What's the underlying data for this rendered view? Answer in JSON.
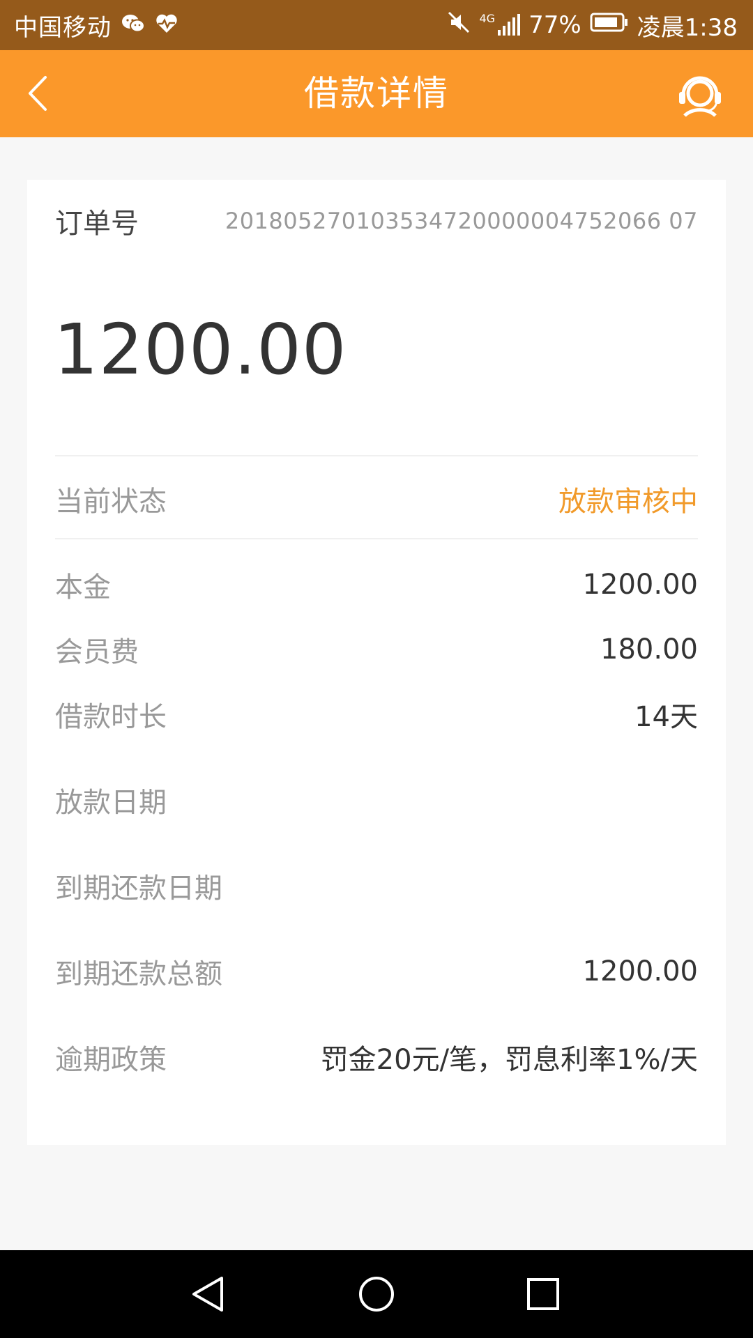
{
  "status_bar": {
    "carrier": "中国移动",
    "network": "4G",
    "battery": "77%",
    "time": "凌晨1:38",
    "icons": [
      "wechat-icon",
      "health-icon",
      "mute-icon",
      "signal-icon",
      "battery-icon"
    ]
  },
  "header": {
    "title": "借款详情",
    "back_icon": "chevron-left-icon",
    "service_icon": "customer-service-icon"
  },
  "order": {
    "label": "订单号",
    "value": "201805270103534720000004752066 07"
  },
  "amount": "1200.00",
  "details": {
    "status": {
      "label": "当前状态",
      "value": "放款审核中"
    },
    "principal": {
      "label": "本金",
      "value": "1200.00"
    },
    "membership_fee": {
      "label": "会员费",
      "value": "180.00"
    },
    "duration": {
      "label": "借款时长",
      "value": "14天"
    },
    "disbursement_date": {
      "label": "放款日期",
      "value": ""
    },
    "due_date": {
      "label": "到期还款日期",
      "value": ""
    },
    "total_due": {
      "label": "到期还款总额",
      "value": "1200.00"
    },
    "overdue_policy": {
      "label": "逾期政策",
      "value": "罚金20元/笔，罚息利率1%/天"
    }
  },
  "colors": {
    "status_bar": "#955a1b",
    "header": "#fb982a",
    "status_text": "#f19a2a",
    "background": "#f7f7f7",
    "nav_bar": "#000000"
  },
  "nav_bar": {
    "icons": [
      "nav-back-icon",
      "nav-home-icon",
      "nav-recents-icon"
    ]
  }
}
